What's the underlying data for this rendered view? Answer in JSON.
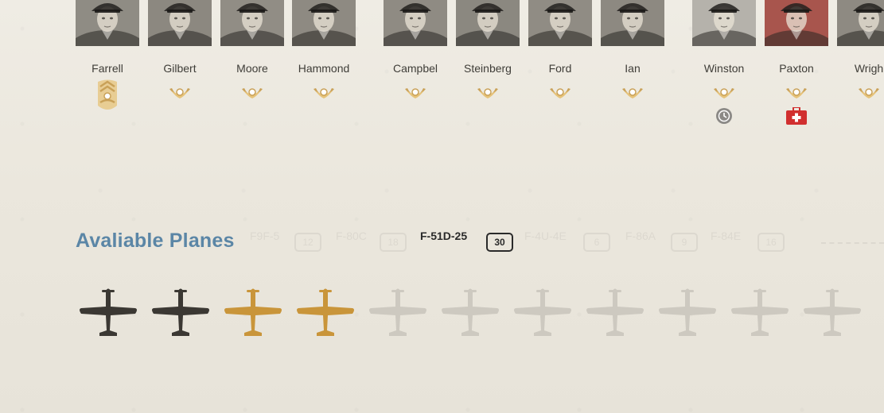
{
  "pilots": [
    {
      "name": "Farrell",
      "rank": "sergeant",
      "status": "none",
      "portrait_tone": "#8f8c84"
    },
    {
      "name": "Gilbert",
      "rank": "private",
      "status": "none",
      "portrait_tone": "#8c8880"
    },
    {
      "name": "Moore",
      "rank": "private",
      "status": "none",
      "portrait_tone": "#918d85"
    },
    {
      "name": "Hammond",
      "rank": "private",
      "status": "none",
      "portrait_tone": "#8e8a82"
    },
    {
      "name": "Campbel",
      "rank": "private",
      "status": "none",
      "portrait_tone": "#8f8b83"
    },
    {
      "name": "Steinberg",
      "rank": "private",
      "status": "none",
      "portrait_tone": "#8b8880"
    },
    {
      "name": "Ford",
      "rank": "private",
      "status": "none",
      "portrait_tone": "#908c84"
    },
    {
      "name": "Ian",
      "rank": "private",
      "status": "none",
      "portrait_tone": "#8d8981"
    },
    {
      "name": "Winston",
      "rank": "private",
      "status": "resting",
      "portrait_tone": "#b5b2ab"
    },
    {
      "name": "Paxton",
      "rank": "private",
      "status": "injured",
      "portrait_tone": "#a8554d"
    },
    {
      "name": "Wrigh",
      "rank": "private",
      "status": "none",
      "portrait_tone": "#8e8a82"
    }
  ],
  "available_planes": {
    "title": "Avaliable Planes",
    "tabs": [
      {
        "label": "F9F-5",
        "count": "12",
        "active": false
      },
      {
        "label": "F-80C",
        "count": "18",
        "active": false
      },
      {
        "label": "F-51D-25",
        "count": "30",
        "active": true
      },
      {
        "label": "F-4U-4E",
        "count": "6",
        "active": false
      },
      {
        "label": "F-86A",
        "count": "9",
        "active": false
      },
      {
        "label": "F-84E",
        "count": "16",
        "active": false
      }
    ],
    "planes": [
      {
        "state": "assigned"
      },
      {
        "state": "assigned"
      },
      {
        "state": "ready"
      },
      {
        "state": "ready"
      },
      {
        "state": "unavailable"
      },
      {
        "state": "unavailable"
      },
      {
        "state": "unavailable"
      },
      {
        "state": "unavailable"
      },
      {
        "state": "unavailable"
      },
      {
        "state": "unavailable"
      },
      {
        "state": "unavailable"
      }
    ]
  },
  "colors": {
    "title": "#5b86a6",
    "insignia_gold": "#e6c37a",
    "insignia_dark": "#c9a158",
    "plane_assigned": "#3b3833",
    "plane_ready": "#c9953a",
    "plane_unavailable": "#cdc9c0",
    "status_clock": "#8b8986",
    "status_medic": "#d12f2f"
  }
}
